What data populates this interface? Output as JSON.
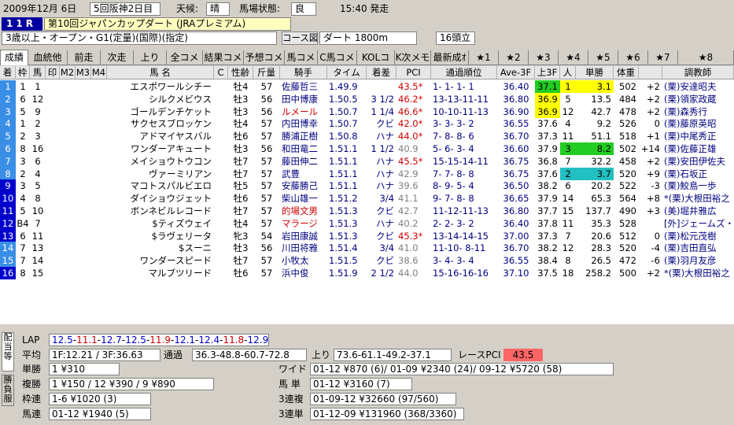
{
  "header": {
    "date": "2009年12月 6日",
    "meeting": "5回阪神2日目",
    "weather_label": "天候:",
    "weather": "晴",
    "track_label": "馬場状態:",
    "track": "良",
    "post_time": "15:40 発走"
  },
  "race": {
    "num": "11R",
    "name": "第10回ジャパンカップダート (JRAプレミアム)",
    "cond": "3歳以上・オープン・G1(定量)(国際)(指定)",
    "course_btn": "コース図",
    "course": "ダート 1800m",
    "heads": "16頭立"
  },
  "tabs": [
    "成績",
    "血統他",
    "前走",
    "次走",
    "上り",
    "全コメ",
    "結果コメ",
    "予想コメ",
    "馬コメ",
    "C馬コメ",
    "KOLコメ",
    "K次メモ",
    "最新成ｵｯｽ",
    "★1",
    "★2",
    "★3",
    "★4",
    "★5",
    "★6",
    "★7",
    "★8"
  ],
  "columns": [
    "着",
    "枠",
    "馬",
    "印",
    "M2",
    "M3",
    "M4",
    "馬 名",
    "C",
    "性齢",
    "斤量",
    "騎手",
    "タイム",
    "着差",
    "PCI",
    "通過順位",
    "Ave-3F",
    "上3F",
    "人",
    "単勝",
    "体重",
    "",
    "調教師"
  ],
  "rows": [
    [
      "1",
      "1",
      "1",
      "",
      "",
      "",
      "",
      "エスポワールシチー",
      "",
      "牡4",
      "57",
      "佐藤哲三",
      "1.49.9",
      "",
      "43.5*",
      "1- 1- 1- 1",
      "36.40",
      "37.1",
      "1",
      "3.1",
      "502",
      "+2",
      "(栗)安達昭夫"
    ],
    [
      "2",
      "6",
      "12",
      "",
      "",
      "",
      "",
      "シルクメビウス",
      "",
      "牡3",
      "56",
      "田中博康",
      "1.50.5",
      "3 1/2",
      "46.2*",
      "13-13-11-11",
      "36.80",
      "36.9",
      "5",
      "13.5",
      "484",
      "+2",
      "(栗)領家政蔵"
    ],
    [
      "3",
      "5",
      "9",
      "",
      "",
      "",
      "",
      "ゴールデンチケット",
      "",
      "牡3",
      "56",
      "ルメール",
      "1.50.7",
      "1 1/4",
      "46.6*",
      "10-10-11-13",
      "36.90",
      "36.9",
      "12",
      "42.7",
      "478",
      "+2",
      "(栗)森秀行"
    ],
    [
      "4",
      "1",
      "2",
      "",
      "",
      "",
      "",
      "サクセスブロッケン",
      "",
      "牡4",
      "57",
      "内田博幸",
      "1.50.7",
      "クビ",
      "42.0*",
      "3- 3- 3- 2",
      "36.55",
      "37.6",
      "4",
      "9.2",
      "526",
      "0",
      "(栗)藤原英昭"
    ],
    [
      "5",
      "2",
      "3",
      "",
      "",
      "",
      "",
      "アドマイヤスバル",
      "",
      "牡6",
      "57",
      "勝浦正樹",
      "1.50.8",
      "ハナ",
      "44.0*",
      "7- 8- 8- 6",
      "36.70",
      "37.3",
      "11",
      "51.1",
      "518",
      "+1",
      "(栗)中尾秀正"
    ],
    [
      "6",
      "8",
      "16",
      "",
      "",
      "",
      "",
      "ワンダーアキュート",
      "",
      "牡3",
      "56",
      "和田竜二",
      "1.51.1",
      "1 1/2",
      "40.9",
      "5- 6- 3- 4",
      "36.60",
      "37.9",
      "3",
      "8.2",
      "502",
      "+14",
      "(栗)佐藤正雄"
    ],
    [
      "7",
      "3",
      "6",
      "",
      "",
      "",
      "",
      "メイショウトウコン",
      "",
      "牡7",
      "57",
      "藤田伸二",
      "1.51.1",
      "ハナ",
      "45.5*",
      "15-15-14-11",
      "36.75",
      "36.8",
      "7",
      "32.2",
      "458",
      "+2",
      "(栗)安田伊佐夫"
    ],
    [
      "8",
      "2",
      "4",
      "",
      "",
      "",
      "",
      "ヴァーミリアン",
      "",
      "牡7",
      "57",
      "武豊",
      "1.51.1",
      "ハナ",
      "42.9",
      "7- 7- 8- 8",
      "36.75",
      "37.6",
      "2",
      "3.7",
      "520",
      "+9",
      "(栗)石坂正"
    ],
    [
      "9",
      "3",
      "5",
      "",
      "",
      "",
      "",
      "マコトスパルビエロ",
      "",
      "牡5",
      "57",
      "安藤勝己",
      "1.51.1",
      "ハナ",
      "39.6",
      "8- 9- 5- 4",
      "36.50",
      "38.2",
      "6",
      "20.2",
      "522",
      "-3",
      "(栗)鮫島一歩"
    ],
    [
      "10",
      "4",
      "8",
      "",
      "",
      "",
      "",
      "ダイショウジェット",
      "",
      "牡6",
      "57",
      "柴山雄一",
      "1.51.2",
      "3/4",
      "41.1",
      "9- 7- 8- 8",
      "36.65",
      "37.9",
      "14",
      "65.3",
      "564",
      "+8",
      "*(栗)大根田裕之"
    ],
    [
      "11",
      "5",
      "10",
      "",
      "",
      "",
      "",
      "ボンネビルレコード",
      "",
      "牡7",
      "57",
      "的場文男",
      "1.51.3",
      "クビ",
      "42.7",
      "11-12-11-13",
      "36.80",
      "37.7",
      "15",
      "137.7",
      "490",
      "+3",
      "(美)堀井雅広"
    ],
    [
      "12",
      "B4",
      "7",
      "",
      "",
      "",
      "",
      "$ティズウェイ",
      "",
      "牡4",
      "57",
      "マラージ",
      "1.51.3",
      "ハナ",
      "40.2",
      "2- 2- 3- 2",
      "36.40",
      "37.8",
      "11",
      "35.3",
      "528",
      "",
      "[外]ジェームズ・ジェラード"
    ],
    [
      "13",
      "6",
      "11",
      "",
      "",
      "",
      "",
      "$ラヴェリータ",
      "",
      "牝3",
      "54",
      "岩田康誠",
      "1.51.3",
      "クビ",
      "45.3*",
      "13-14-14-15",
      "37.00",
      "37.3",
      "7",
      "20.6",
      "512",
      "0",
      "(栗)松元茂樹"
    ],
    [
      "14",
      "7",
      "13",
      "",
      "",
      "",
      "",
      "$スーニ",
      "",
      "牡3",
      "56",
      "川田将雅",
      "1.51.4",
      "3/4",
      "41.0",
      "11-10- 8-11",
      "36.70",
      "38.2",
      "12",
      "28.3",
      "520",
      "-4",
      "(栗)吉田直弘"
    ],
    [
      "15",
      "7",
      "14",
      "",
      "",
      "",
      "",
      "ワンダースピード",
      "",
      "牡7",
      "57",
      "小牧太",
      "1.51.5",
      "クビ",
      "38.6",
      "3- 4- 3- 4",
      "36.55",
      "38.4",
      "8",
      "26.5",
      "472",
      "-6",
      "(栗)羽月友彦"
    ],
    [
      "16",
      "8",
      "15",
      "",
      "",
      "",
      "",
      "マルブツリード",
      "",
      "牡6",
      "57",
      "浜中俊",
      "1.51.9",
      "2 1/2",
      "44.0",
      "15-16-16-16",
      "37.10",
      "37.5",
      "18",
      "258.2",
      "500",
      "+2",
      "*(栗)大根田裕之"
    ]
  ],
  "summary": {
    "side_tab1": "配当等",
    "side_tab2": "勝負服",
    "lap_label": "LAP",
    "lap": [
      [
        "12.5",
        "b"
      ],
      [
        "-",
        "k"
      ],
      [
        "11.1",
        "r"
      ],
      [
        "-",
        "k"
      ],
      [
        "12.7",
        "b"
      ],
      [
        "-",
        "k"
      ],
      [
        "12.5",
        "b"
      ],
      [
        "-",
        "k"
      ],
      [
        "11.9",
        "r"
      ],
      [
        "-",
        "k"
      ],
      [
        "12.1",
        "b"
      ],
      [
        "-",
        "k"
      ],
      [
        "12.4",
        "b"
      ],
      [
        "-",
        "k"
      ],
      [
        "11.8",
        "r"
      ],
      [
        "-",
        "k"
      ],
      [
        "12.9",
        "b"
      ]
    ],
    "avg_label": "平均",
    "avg": "1F:12.21 / 3F:36.63",
    "pass_label": "通過",
    "pass": "36.3-48.8-60.7-72.8",
    "agari_label": "上り",
    "agari": "73.6-61.1-49.2-37.1",
    "pci_label": "レースPCI",
    "pci": "43.5",
    "win_label": "単勝",
    "win": "1 ¥310",
    "place_label": "複勝",
    "place": "1 ¥150 / 12 ¥390 / 9 ¥890",
    "bracket_label": "枠連",
    "bracket": "1-6 ¥1020 (3)",
    "quinella_label": "馬連",
    "quinella": "01-12 ¥1940 (5)",
    "wide_label": "ワイド",
    "wide": "01-12 ¥870 (6)/ 01-09 ¥2340 (24)/ 09-12 ¥5720 (58)",
    "exacta_label": "馬 単",
    "exacta": "01-12 ¥3160 (7)",
    "trio_label": "3連複",
    "trio": "01-09-12 ¥32660 (97/560)",
    "trifecta_label": "3連単",
    "trifecta": "01-12-09 ¥131960 (368/3360)"
  },
  "colors": {
    "waku": [
      "#3a8ee6",
      "#3a8ee6",
      "#3a8ee6",
      "#3a8ee6",
      "#3a8ee6",
      "#3a8ee6",
      "#3a8ee6",
      "#3a8ee6",
      "#0000cc",
      "#0000cc",
      "#0000cc",
      "#0000cc",
      "#0000cc",
      "#3a8ee6",
      "#3a8ee6",
      "#0000cc"
    ],
    "pci_hi": "#cc0000",
    "lap_red": "#cc0000",
    "lap_blue": "#0000cc",
    "race_num_bg": "#0000a0",
    "up3f": "#ffff00",
    "up3f_green": "#22cc22",
    "up3f_cyan": "#22c0c0",
    "pci_box": "#ff6666"
  }
}
